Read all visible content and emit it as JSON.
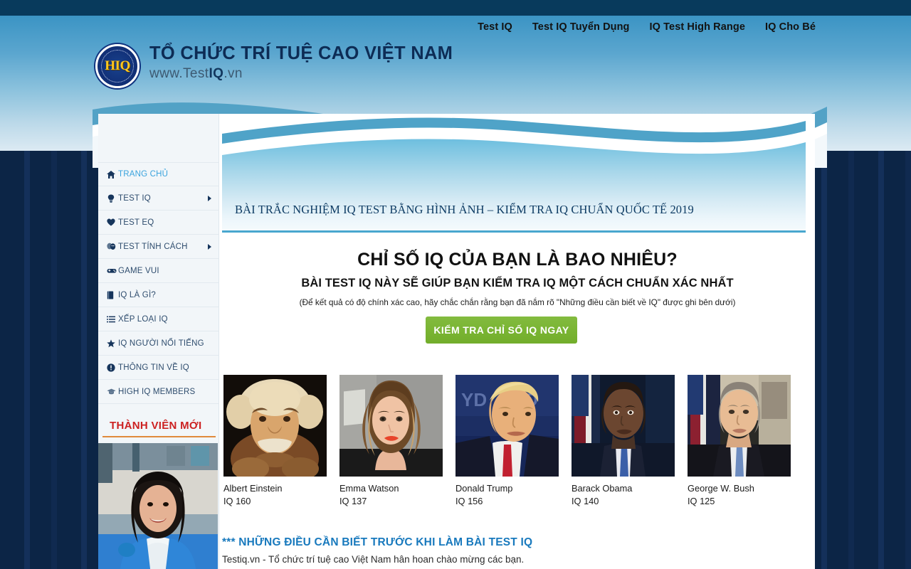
{
  "topnav": {
    "items": [
      {
        "label": "Test IQ"
      },
      {
        "label": "Test IQ Tuyển Dụng"
      },
      {
        "label": "IQ Test High Range"
      },
      {
        "label": "IQ Cho Bé"
      }
    ]
  },
  "brand": {
    "seal_text": "HIQ",
    "title": "TỔ CHỨC TRÍ TUỆ CAO VIỆT NAM",
    "sub_prefix": "www.Test",
    "sub_bold": "IQ",
    "sub_suffix": ".vn"
  },
  "sidebar": {
    "items": [
      {
        "label": "TRANG CHỦ",
        "icon": "home-icon",
        "glyph": "⌂",
        "active": true,
        "arrow": false
      },
      {
        "label": "TEST IQ",
        "icon": "lightbulb-icon",
        "glyph": "💡",
        "active": false,
        "arrow": true
      },
      {
        "label": "TEST EQ",
        "icon": "heart-icon",
        "glyph": "♥",
        "active": false,
        "arrow": false
      },
      {
        "label": "TEST TÍNH CÁCH",
        "icon": "theater-masks-icon",
        "glyph": "🎭",
        "active": false,
        "arrow": true
      },
      {
        "label": "GAME VUI",
        "icon": "gamepad-icon",
        "glyph": "🎮",
        "active": false,
        "arrow": false
      },
      {
        "label": "IQ LÀ GÌ?",
        "icon": "book-icon",
        "glyph": "📕",
        "active": false,
        "arrow": false
      },
      {
        "label": "XẾP LOẠI IQ",
        "icon": "list-icon",
        "glyph": "☰",
        "active": false,
        "arrow": false
      },
      {
        "label": "IQ NGƯỜI NỔI TIẾNG",
        "icon": "star-icon",
        "glyph": "★",
        "active": false,
        "arrow": false
      },
      {
        "label": "THÔNG TIN VỀ IQ",
        "icon": "info-icon",
        "glyph": "!",
        "active": false,
        "arrow": false
      },
      {
        "label": "HIGH IQ MEMBERS",
        "icon": "graduation-cap-icon",
        "glyph": "▲",
        "active": false,
        "arrow": false
      }
    ],
    "members_widget": {
      "title": "THÀNH VIÊN MỚI"
    }
  },
  "banner": {
    "title": "BÀI TRẮC NGHIỆM IQ TEST BẰNG HÌNH ẢNH – KIỂM TRA IQ CHUẨN QUỐC TẾ 2019"
  },
  "main": {
    "heading": "CHỈ SỐ IQ CỦA BẠN LÀ BAO NHIÊU?",
    "subheading": "BÀI TEST IQ NÀY SẼ GIÚP BẠN KIỂM TRA IQ MỘT CÁCH CHUẨN XÁC NHẤT",
    "note": "(Để kết quả có độ chính xác cao, hãy chắc chắn rằng bạn đã nắm rõ \"Những điều cần biết về IQ\" được ghi bên dưới)",
    "cta_label": "KIỂM TRA CHỈ SỐ IQ NGAY",
    "celebrities": [
      {
        "name": "Albert Einstein",
        "iq": "IQ 160"
      },
      {
        "name": "Emma Watson",
        "iq": "IQ 137"
      },
      {
        "name": "Donald Trump",
        "iq": "IQ 156"
      },
      {
        "name": "Barack Obama",
        "iq": "IQ 140"
      },
      {
        "name": "George W. Bush",
        "iq": "IQ 125"
      }
    ],
    "notes_title": "*** NHỮNG ĐIỀU CẦN BIẾT TRƯỚC KHI LÀM BÀI TEST IQ",
    "notes_line": "Testiq.vn - Tổ chức trí tuệ cao Việt Nam hân hoan chào mừng các bạn."
  },
  "colors": {
    "top_strip": "#083a5c",
    "header_top": "#3b94c4",
    "page_bg": "#0c2546",
    "cta_green": "#79b432",
    "accent_blue": "#1879bd",
    "members_red": "#cc2121",
    "members_rule": "#e08a3c"
  }
}
